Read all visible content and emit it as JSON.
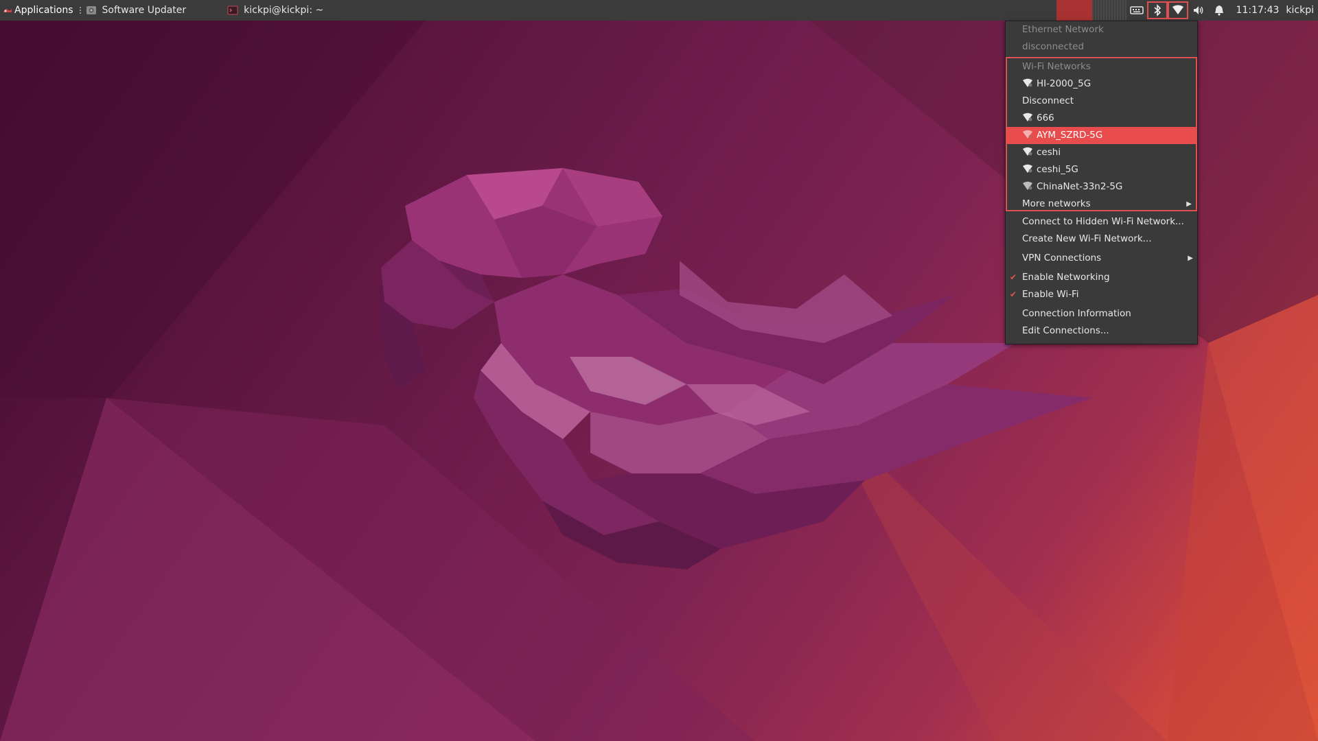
{
  "panel": {
    "applications_label": "Applications",
    "tasks": [
      {
        "label": "Software Updater",
        "icon": "software-updater-icon"
      },
      {
        "label": "kickpi@kickpi: ~",
        "icon": "terminal-icon"
      }
    ],
    "tray_icons": [
      "keyboard-icon",
      "bluetooth-icon",
      "wifi-icon",
      "volume-icon",
      "bell-icon"
    ],
    "clock": "11:17:43",
    "user": "kickpi",
    "colors": {
      "panel_bg": "#3b3b3b",
      "accent": "#e94c4c"
    }
  },
  "network_menu": {
    "ethernet_header": "Ethernet Network",
    "ethernet_status": "disconnected",
    "wifi_header": "Wi-Fi Networks",
    "wifi_networks": [
      {
        "label": "HI-2000_5G",
        "icon": "wifi-signal-icon"
      },
      {
        "label": "Disconnect",
        "icon": ""
      },
      {
        "label": "666",
        "icon": "wifi-signal-icon"
      },
      {
        "label": "AYM_SZRD-5G",
        "icon": "wifi-signal-icon",
        "selected": true
      },
      {
        "label": "ceshi",
        "icon": "wifi-signal-icon"
      },
      {
        "label": "ceshi_5G",
        "icon": "wifi-signal-icon"
      },
      {
        "label": "ChinaNet-33n2-5G",
        "icon": "wifi-signal-icon"
      }
    ],
    "more_networks": "More networks",
    "connect_hidden": "Connect to Hidden Wi-Fi Network...",
    "create_new": "Create New Wi-Fi Network...",
    "vpn": "VPN Connections",
    "enable_networking": "Enable Networking",
    "enable_wifi": "Enable Wi-Fi",
    "connection_info": "Connection Information",
    "edit_connections": "Edit Connections..."
  }
}
